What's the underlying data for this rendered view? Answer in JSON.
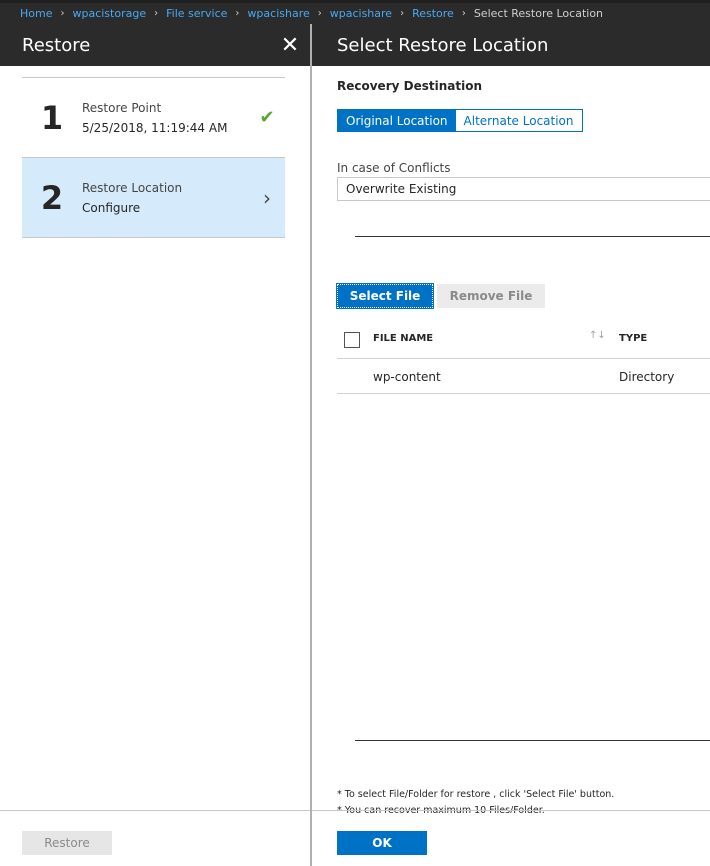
{
  "breadcrumb": {
    "items": [
      "Home",
      "wpacistorage",
      "File service",
      "wpacishare",
      "wpacishare",
      "Restore"
    ],
    "current": "Select Restore Location"
  },
  "left": {
    "title": "Restore",
    "steps": [
      {
        "number": "1",
        "title": "Restore Point",
        "subtitle": "5/25/2018, 11:19:44 AM",
        "status_icon": "check-icon"
      },
      {
        "number": "2",
        "title": "Restore Location",
        "subtitle": "Configure",
        "status_icon": "chevron-right-icon"
      }
    ],
    "restore_label": "Restore"
  },
  "right": {
    "title": "Select Restore Location",
    "recovery_label": "Recovery Destination",
    "destination_options": [
      "Original Location",
      "Alternate Location"
    ],
    "conflicts_label": "In case of Conflicts",
    "conflicts_value": "Overwrite Existing",
    "select_file_label": "Select File",
    "remove_file_label": "Remove File",
    "table": {
      "columns": [
        "FILE NAME",
        "TYPE"
      ],
      "rows": [
        {
          "name": "wp-content",
          "type": "Directory"
        }
      ]
    },
    "notes": [
      "* To select File/Folder for restore , click 'Select File' button.",
      "* You can recover maximum 10 Files/Folder."
    ],
    "ok_label": "OK"
  },
  "colors": {
    "accent": "#0072c6",
    "header_bg": "#2b2b2b",
    "link": "#4aa8f0",
    "selected_step_bg": "#d5ebfb",
    "check": "#5ba829"
  }
}
